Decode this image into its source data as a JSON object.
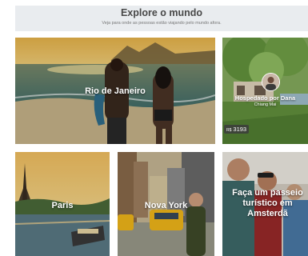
{
  "header": {
    "title": "Explore o mundo",
    "subtitle": "Veja para onde as pessoas estão viajando pelo mundo afora."
  },
  "cards": [
    {
      "title": "Rio de Janeiro"
    },
    {
      "title": "Hospedado por Dana",
      "subtitle": "Chiang Mai",
      "price_currency": "R$",
      "price": "3193"
    },
    {
      "title": "Paris"
    },
    {
      "title": "Nova York"
    },
    {
      "title": "Faça um passeio turístico em Amsterdã"
    }
  ]
}
